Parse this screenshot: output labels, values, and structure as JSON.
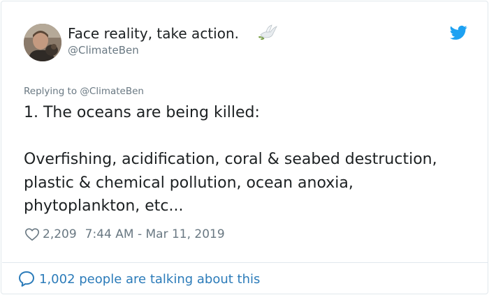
{
  "user": {
    "display_name": "Face reality, take action.",
    "handle": "@ClimateBen",
    "name_emoji_icon": "dove-with-olive-branch-icon",
    "avatar_icon": "profile-photo"
  },
  "brand": {
    "icon": "twitter-bird-icon",
    "color": "#1da1f2"
  },
  "reply": {
    "prefix": "Replying to",
    "mention": "@ClimateBen"
  },
  "tweet": {
    "line1": "1. The oceans are being killed:",
    "line2": "Overfishing, acidification, coral & seabed destruction, plastic & chemical pollution, ocean anoxia, phytoplankton, etc..."
  },
  "meta": {
    "like_icon": "heart-outline-icon",
    "like_count": "2,209",
    "timestamp": "7:44 AM - Mar 11, 2019"
  },
  "footer": {
    "icon": "speech-bubble-icon",
    "talking_text": "1,002 people are talking about this",
    "link_color": "#2b7bb9"
  }
}
